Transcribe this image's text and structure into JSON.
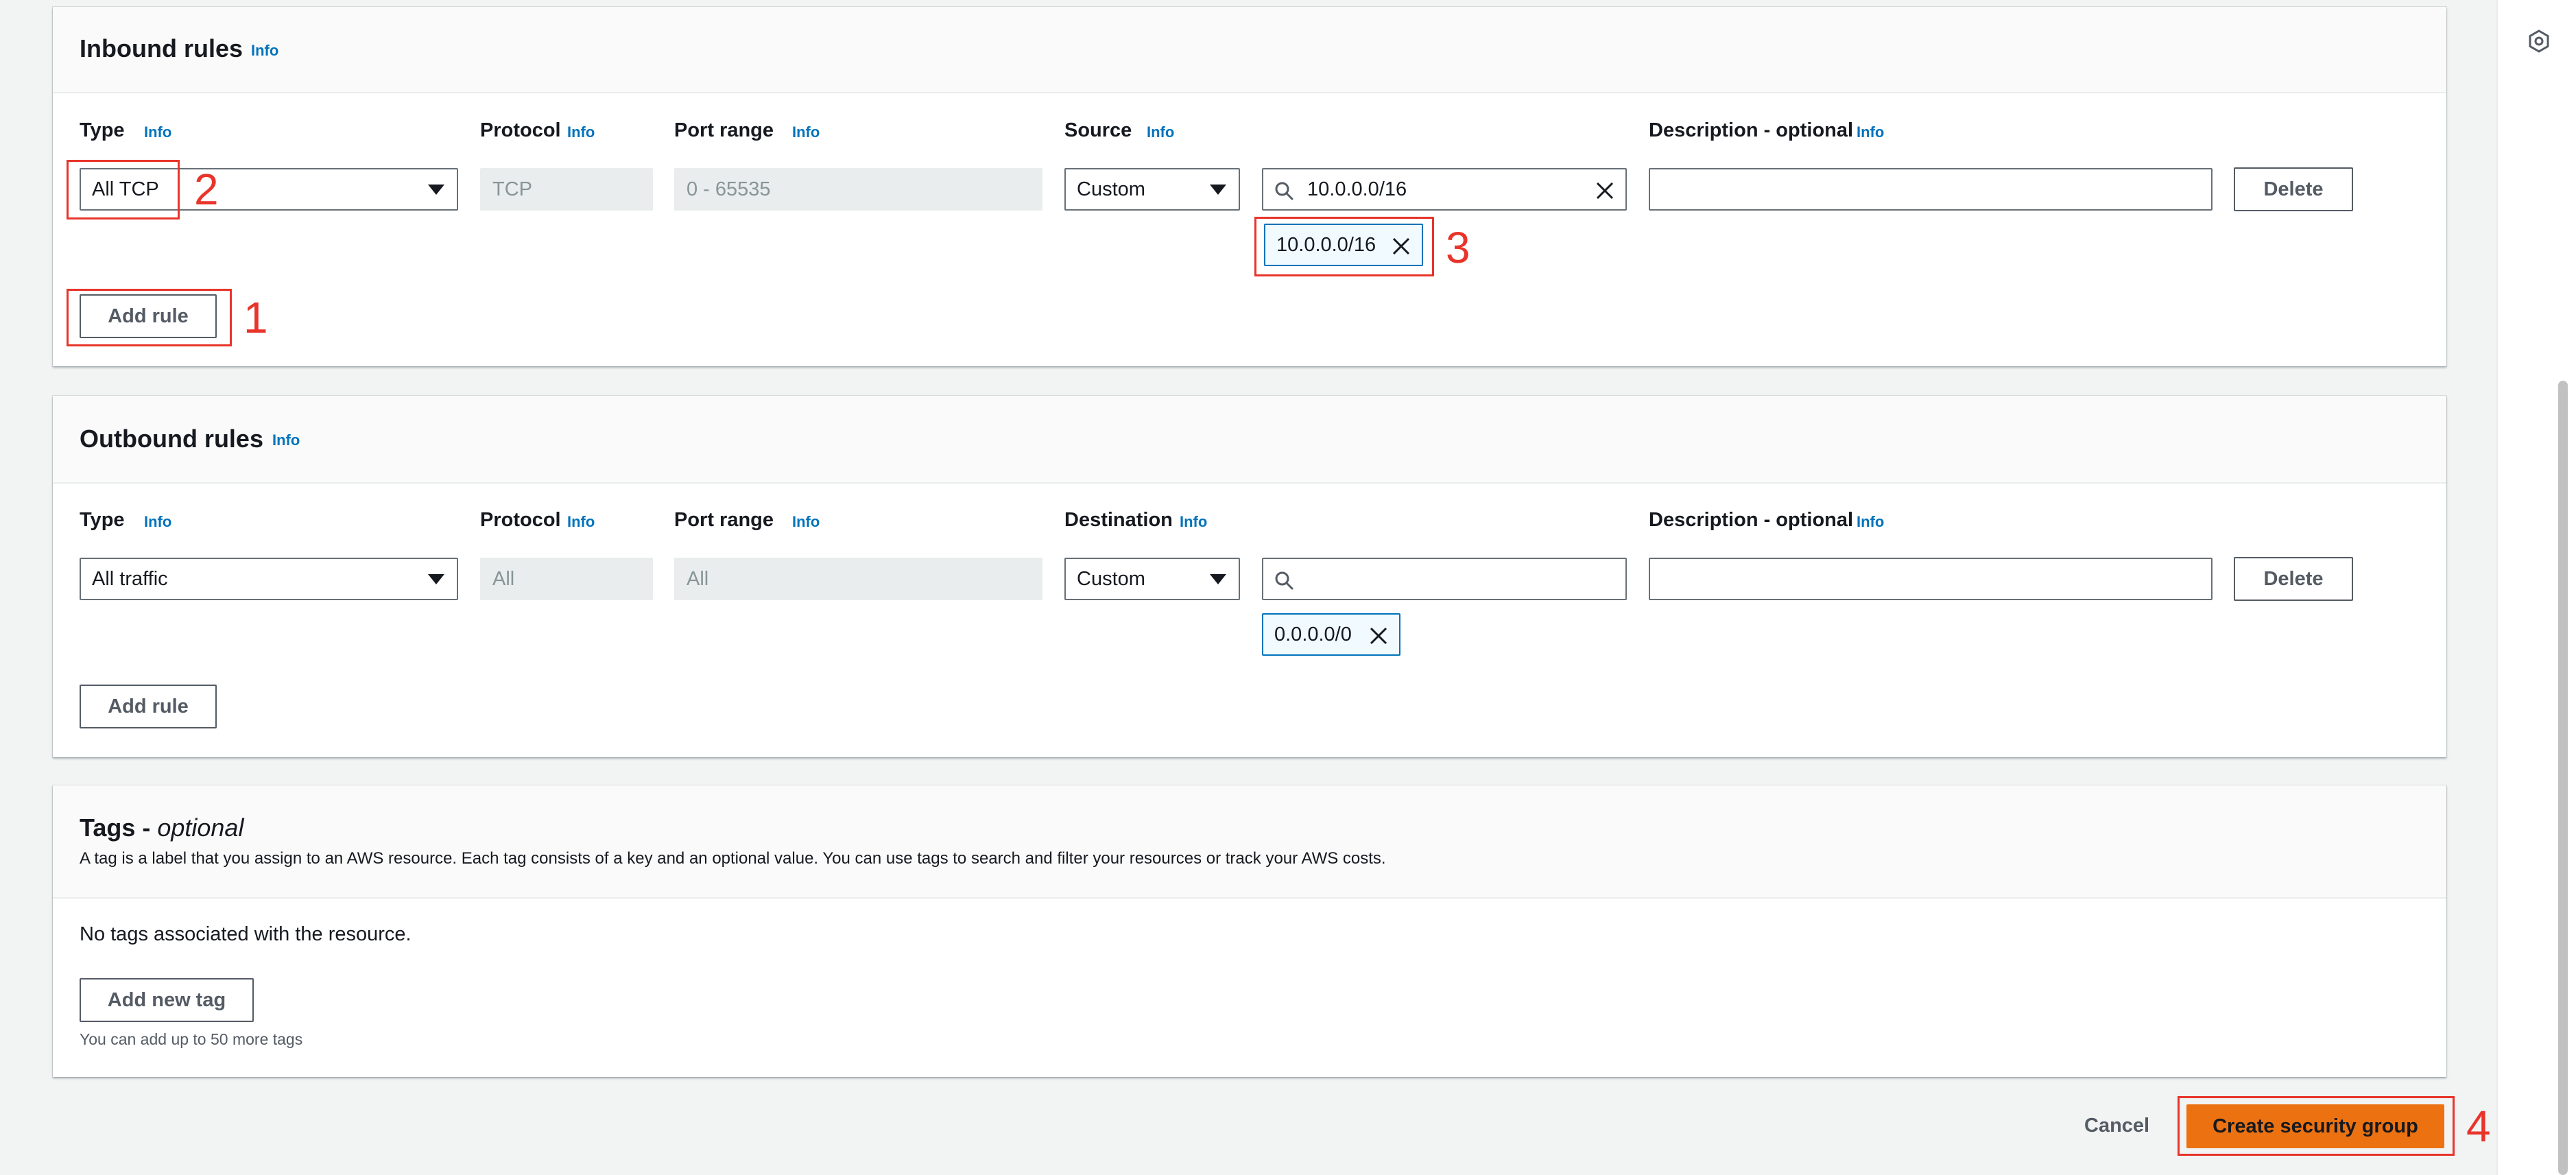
{
  "info_label": "Info",
  "inbound": {
    "title": "Inbound rules",
    "columns": {
      "type": "Type",
      "protocol": "Protocol",
      "port_range": "Port range",
      "source": "Source",
      "description": "Description - optional"
    },
    "rule": {
      "type": "All TCP",
      "protocol": "TCP",
      "port_range": "0 - 65535",
      "source_type": "Custom",
      "source_search": "10.0.0.0/16",
      "source_token": "10.0.0.0/16",
      "description": ""
    },
    "delete_label": "Delete",
    "add_rule_label": "Add rule"
  },
  "outbound": {
    "title": "Outbound rules",
    "columns": {
      "type": "Type",
      "protocol": "Protocol",
      "port_range": "Port range",
      "destination": "Destination",
      "description": "Description - optional"
    },
    "rule": {
      "type": "All traffic",
      "protocol": "All",
      "port_range": "All",
      "destination_type": "Custom",
      "destination_search": "",
      "destination_token": "0.0.0.0/0",
      "description": ""
    },
    "delete_label": "Delete",
    "add_rule_label": "Add rule"
  },
  "tags": {
    "title": "Tags - ",
    "title_optional": "optional",
    "description": "A tag is a label that you assign to an AWS resource. Each tag consists of a key and an optional value. You can use tags to search and filter your resources or track your AWS costs.",
    "empty_text": "No tags associated with the resource.",
    "add_tag_label": "Add new tag",
    "limit_text": "You can add up to 50 more tags"
  },
  "footer": {
    "cancel_label": "Cancel",
    "create_label": "Create security group"
  },
  "annotations": [
    "1",
    "2",
    "3",
    "4"
  ],
  "colors": {
    "accent_link": "#0073bb",
    "primary_button": "#ec7211",
    "annotation": "#e8342a",
    "token_border": "#0073bb"
  }
}
